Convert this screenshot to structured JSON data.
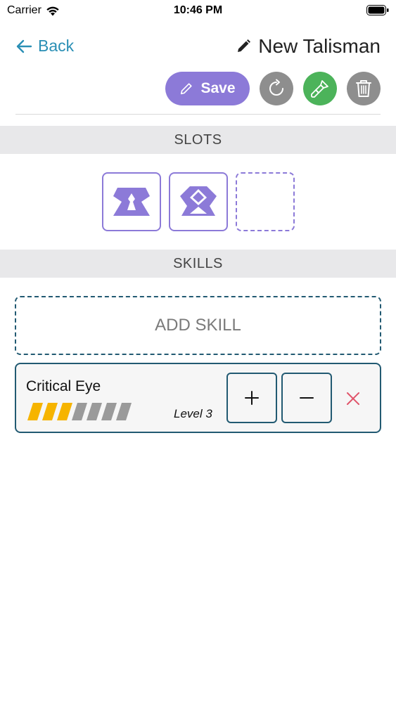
{
  "status_bar": {
    "carrier": "Carrier",
    "time": "10:46 PM",
    "icons": [
      "wifi-icon",
      "battery-icon"
    ]
  },
  "nav": {
    "back_label": "Back",
    "back_icon": "arrow-left-icon",
    "title": "New Talisman",
    "title_icon": "pencil-icon"
  },
  "toolbar": {
    "save_label": "Save",
    "save_icon": "pencil-icon",
    "buttons": [
      "refresh-icon",
      "paint-brush-icon",
      "trash-icon"
    ]
  },
  "sections": {
    "slots_title": "SLOTS",
    "skills_title": "SKILLS"
  },
  "slots": [
    {
      "filled": true,
      "icon": "slot-decoration-level-1-icon"
    },
    {
      "filled": true,
      "icon": "slot-decoration-level-2-icon"
    },
    {
      "filled": false
    }
  ],
  "add_skill_label": "ADD SKILL",
  "skills": [
    {
      "name": "Critical Eye",
      "level_label": "Level 3",
      "level": 3,
      "max_level": 7
    }
  ],
  "colors": {
    "accent": "#8c7ad8",
    "link": "#2a8fb5",
    "border": "#225a72",
    "green": "#4cb35a",
    "grey_button": "#8e8e8e",
    "remove": "#e0546a",
    "level_filled": "#f6b400",
    "level_empty": "#9a9a9a"
  }
}
